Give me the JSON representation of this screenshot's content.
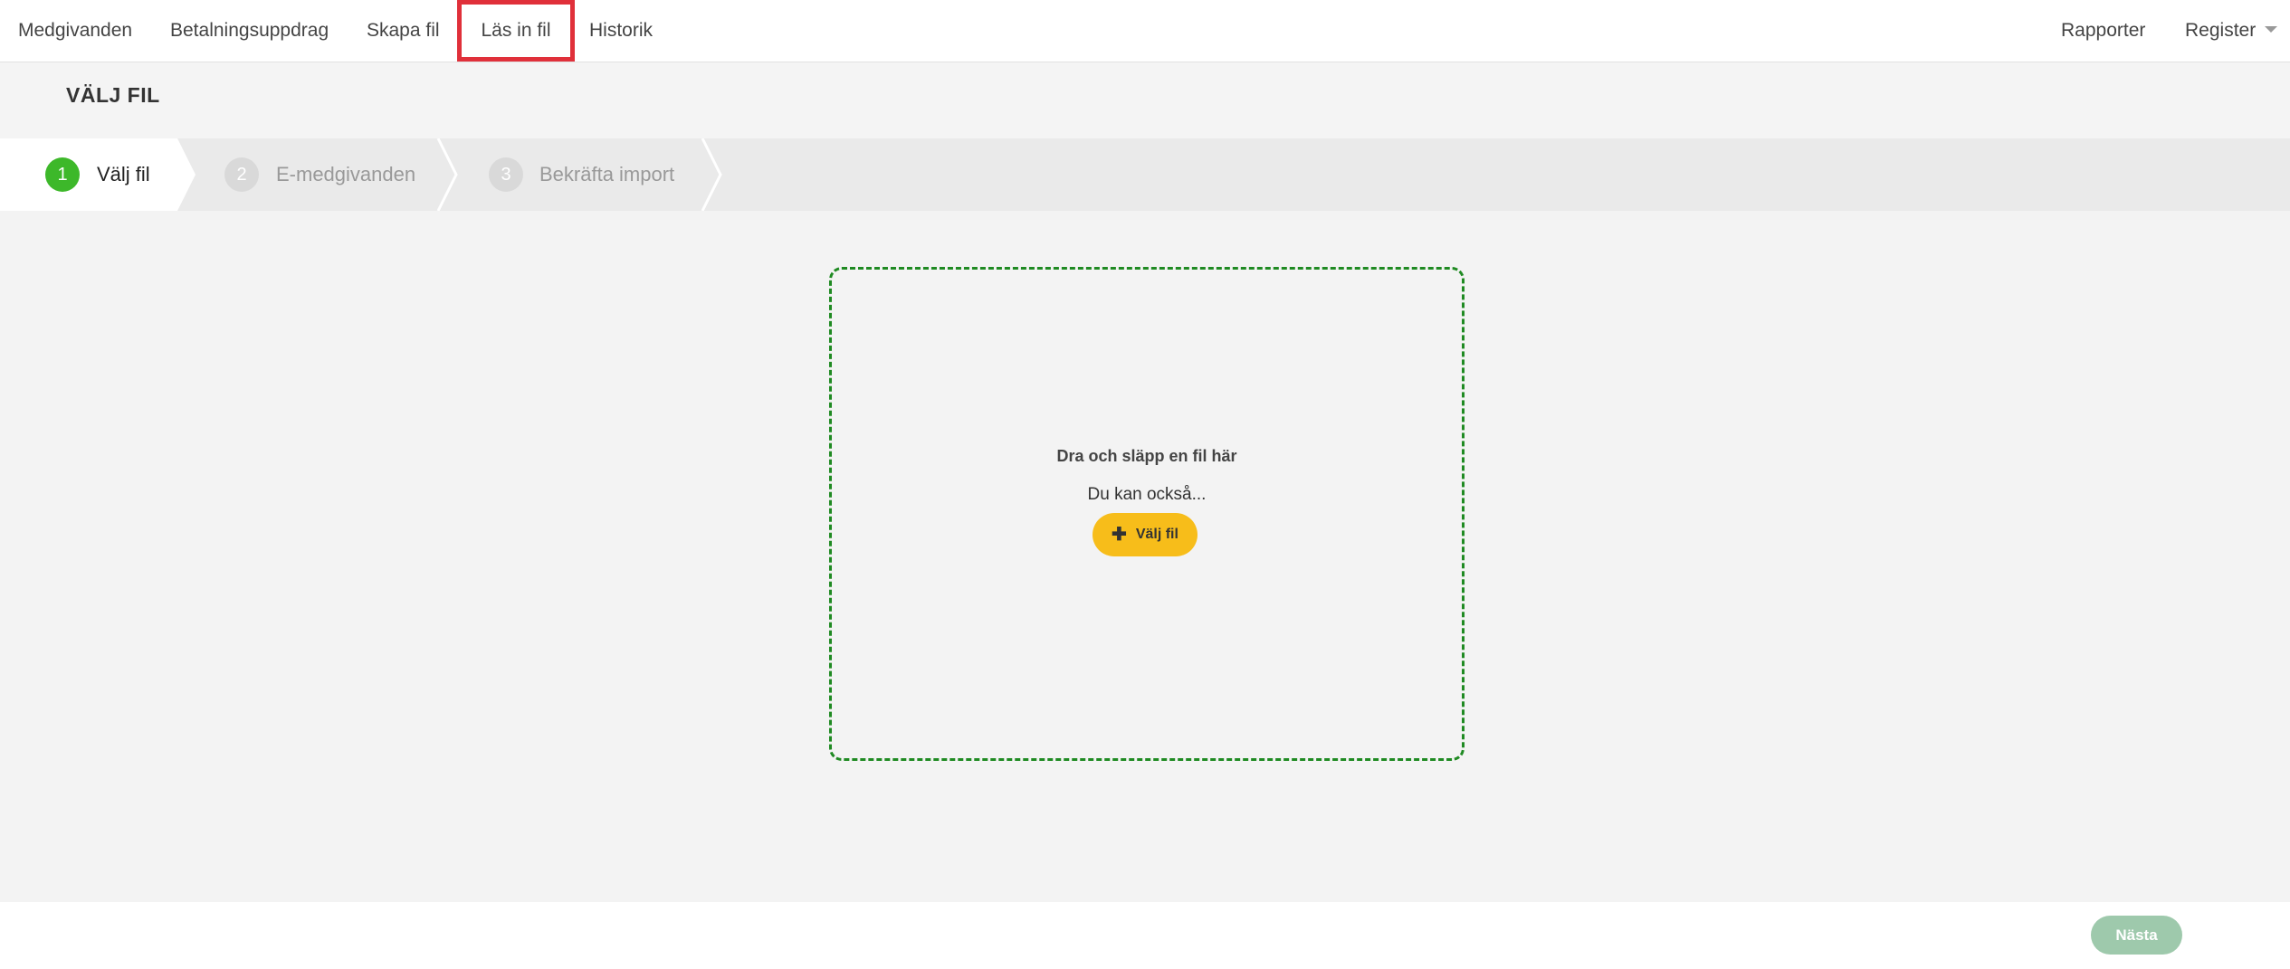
{
  "nav": {
    "items": [
      {
        "label": "Medgivanden"
      },
      {
        "label": "Betalningsuppdrag"
      },
      {
        "label": "Skapa fil"
      },
      {
        "label": "Läs in fil"
      },
      {
        "label": "Historik"
      }
    ],
    "right_items": [
      {
        "label": "Rapporter"
      },
      {
        "label": "Register"
      }
    ],
    "active_item": "Läs in fil",
    "highlight_color": "#e0303a"
  },
  "page": {
    "title": "VÄLJ FIL"
  },
  "stepper": {
    "steps": [
      {
        "number": "1",
        "label": "Välj fil",
        "state": "active"
      },
      {
        "number": "2",
        "label": "E-medgivanden",
        "state": "inactive"
      },
      {
        "number": "3",
        "label": "Bekräfta import",
        "state": "inactive"
      }
    ],
    "active_color": "#3db82a"
  },
  "dropzone": {
    "title": "Dra och släpp en fil här",
    "subtitle": "Du kan också...",
    "button_label": "Välj fil",
    "button_icon": "plus-icon",
    "border_color": "#1f8a22",
    "button_color": "#f7bd1a"
  },
  "footer": {
    "next_label": "Nästa",
    "next_color": "#9ec9ac"
  }
}
